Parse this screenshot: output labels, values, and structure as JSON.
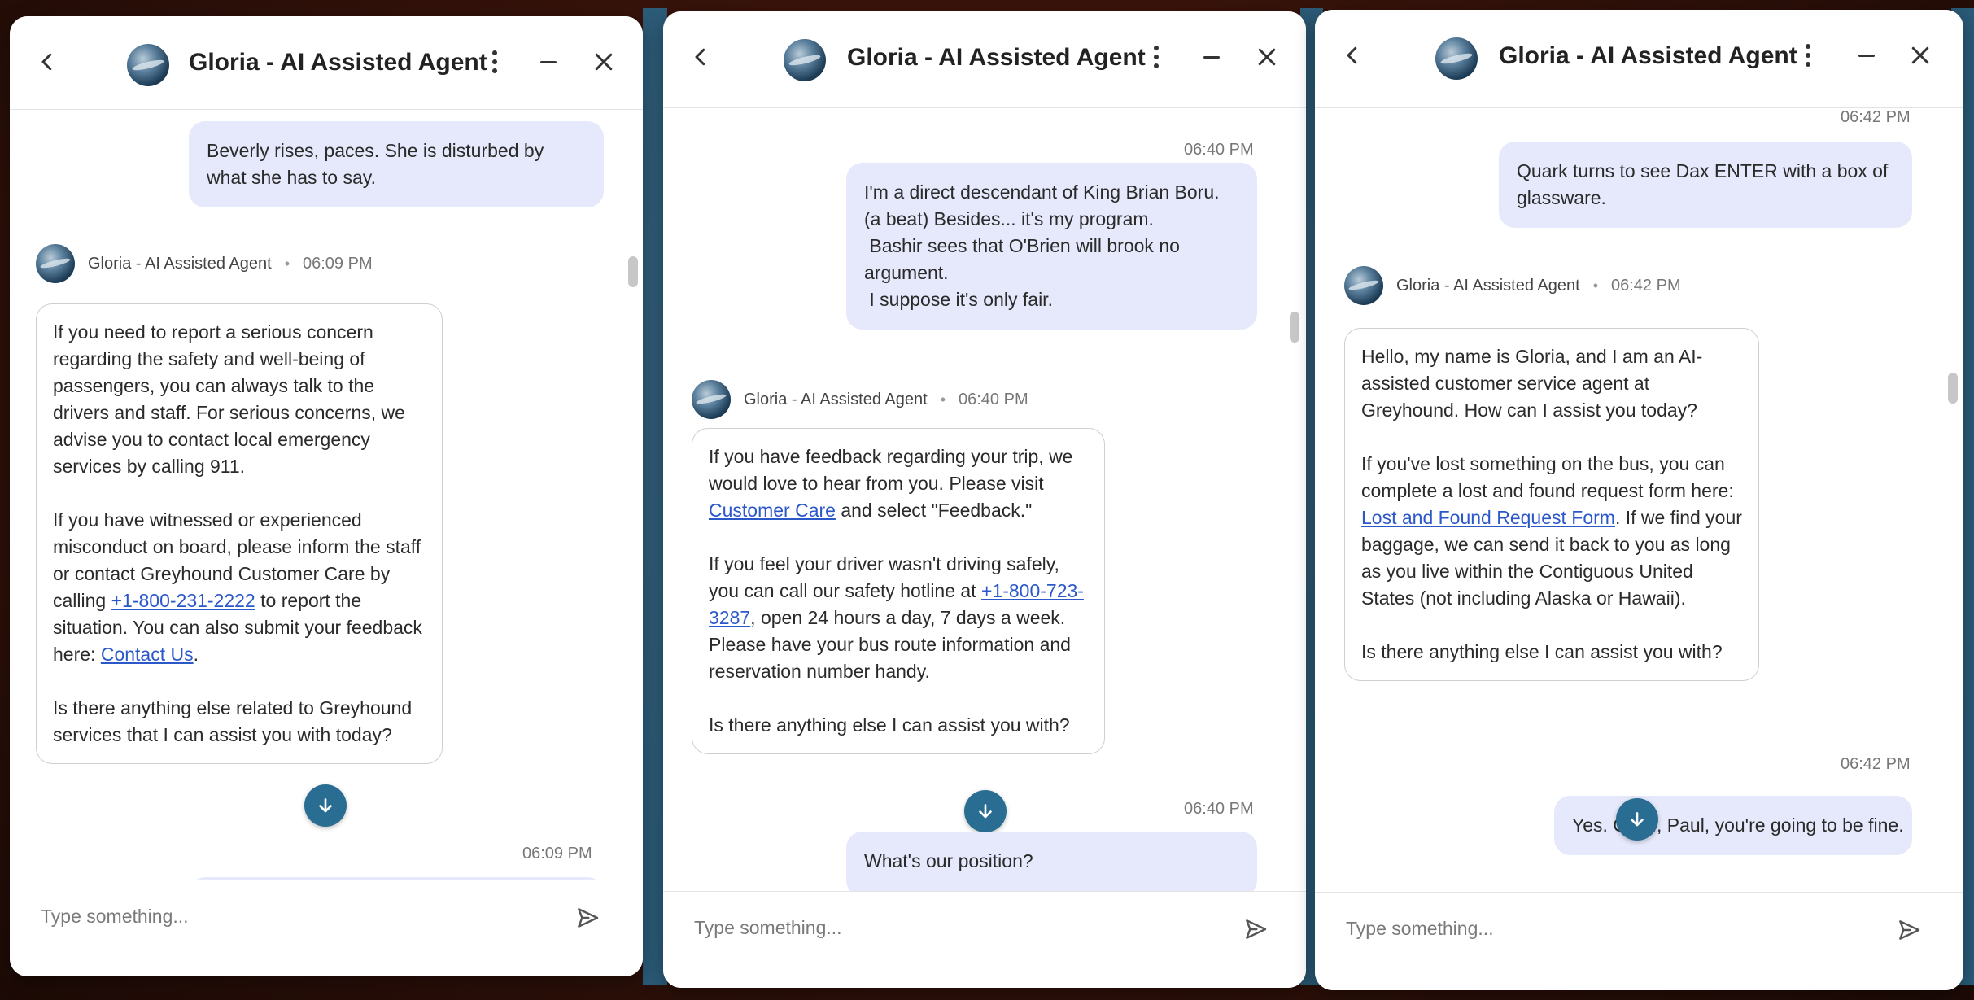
{
  "agent_title": "Gloria - AI Assisted Agent",
  "agent_name": "Gloria - AI Assisted Agent",
  "composer_placeholder": "Type something...",
  "windows": [
    {
      "user_msg_1": "Beverly rises, paces. She is disturbed by what she has to say.",
      "agent_time": "06:09 PM",
      "bot_p1": "If you need to report a serious concern regarding the safety and well-being of passengers, you can always talk to the drivers and staff. For serious concerns, we advise you to contact local emergency services by calling 911.",
      "bot_p2_a": "If you have witnessed or experienced misconduct on board, please inform the staff or contact Greyhound Customer Care by calling ",
      "bot_p2_link": "+1-800-231-2222",
      "bot_p2_b": " to report the situation. You can also submit your feedback here: ",
      "bot_p2_link2": "Contact Us",
      "bot_p2_c": ".",
      "bot_p3": "Is there anything else related to Greyhound services that I can assist you with today?",
      "ts_bottom": "06:09 PM"
    },
    {
      "ts_top": "06:40 PM",
      "user_msg_lines": [
        "I'm a direct descendant of King Brian Boru.",
        "(a beat) Besides... it's my program.",
        " Bashir sees that O'Brien will brook no",
        "argument.",
        " I suppose it's only fair."
      ],
      "agent_time": "06:40 PM",
      "bot_p1_a": "If you have feedback regarding your trip, we would love to hear from you. Please visit ",
      "bot_p1_link": "Customer Care",
      "bot_p1_b": " and select \"Feedback.\"",
      "bot_p2_a": "If you feel your driver wasn't driving safely, you can call our safety hotline at ",
      "bot_p2_link": "+1-800-723-3287",
      "bot_p2_b": ", open 24 hours a day, 7 days a week. Please have your bus route information and reservation number handy.",
      "bot_p3": "Is there anything else I can assist you with?",
      "ts_bottom": "06:40 PM",
      "user_msg_2": "What's our position?"
    },
    {
      "ts_top": "06:42 PM",
      "user_msg_1": "Quark turns to see Dax ENTER with a box of glassware.",
      "agent_time": "06:42 PM",
      "bot_p1": "Hello, my name is Gloria, and I am an AI-assisted customer service agent at Greyhound. How can I assist you today?",
      "bot_p2_a": "If you've lost something on the bus, you can complete a lost and found request form here: ",
      "bot_p2_link": "Lost and Found Request Form",
      "bot_p2_b": ". If we find your baggage, we can send it back to you as long as you live within the Contiguous United States (not including Alaska or Hawaii).",
      "bot_p3": "Is there anything else I can assist you with?",
      "ts_bottom": "06:42 PM",
      "user_msg_2": "Yes. Chief, Paul, you're going to be fine."
    }
  ]
}
